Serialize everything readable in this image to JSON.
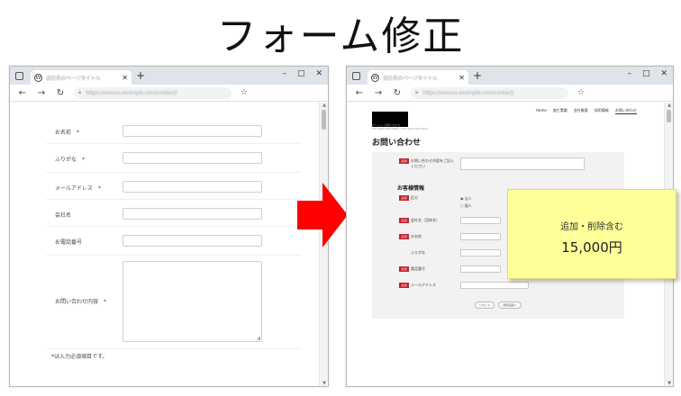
{
  "page": {
    "title": "フォーム修正"
  },
  "browser_left": {
    "tab_label": "会社名のページタイトル",
    "url": "https://xxxxxx.example.com/contact/",
    "window_controls": [
      "–",
      "□",
      "✕"
    ]
  },
  "browser_right": {
    "tab_label": "会社名のページタイトル",
    "url": "https://xxxxxx.example.com/contact/",
    "window_controls": [
      "–",
      "□",
      "✕"
    ]
  },
  "left_form": {
    "fields": [
      {
        "label": "お名前",
        "required": "*"
      },
      {
        "label": "ふりがな",
        "required": "*"
      },
      {
        "label": "メールアドレス",
        "required": "*"
      },
      {
        "label": "会社名",
        "required": ""
      },
      {
        "label": "お電話番号",
        "required": ""
      }
    ],
    "textarea_label": "お問い合わせ内容",
    "textarea_required": "*",
    "note": "*は入力必須項目です。"
  },
  "right_site": {
    "nav": [
      "Home",
      "施工実績",
      "会社概要",
      "採用情報",
      "お問い合わせ"
    ],
    "tagline": "TEL 0000-000-0000 / FAX 0000-000-0000",
    "breadcrumb": "ホーム > お問い合わせ",
    "page_title": "お問い合わせ",
    "badge": "必須",
    "inquiry_label": "お問い合わせ内容をご記入ください",
    "section_title": "お客様情報",
    "type_label": "区分",
    "radio_1": "法人",
    "radio_2": "個人",
    "company_label": "会社名（団体名）",
    "name_label": "お名前",
    "kana_label": "ふりがな",
    "phone_label": "電話番号",
    "email_label": "メールアドレス",
    "reset_button": "リセット",
    "confirm_button": "確認画面へ"
  },
  "sticky_note": {
    "line1": "追加・削除含む",
    "line2": "15,000円"
  },
  "colors": {
    "arrow": "#ff0000",
    "sticky": "#ffff9a",
    "badge": "#c0272d"
  }
}
